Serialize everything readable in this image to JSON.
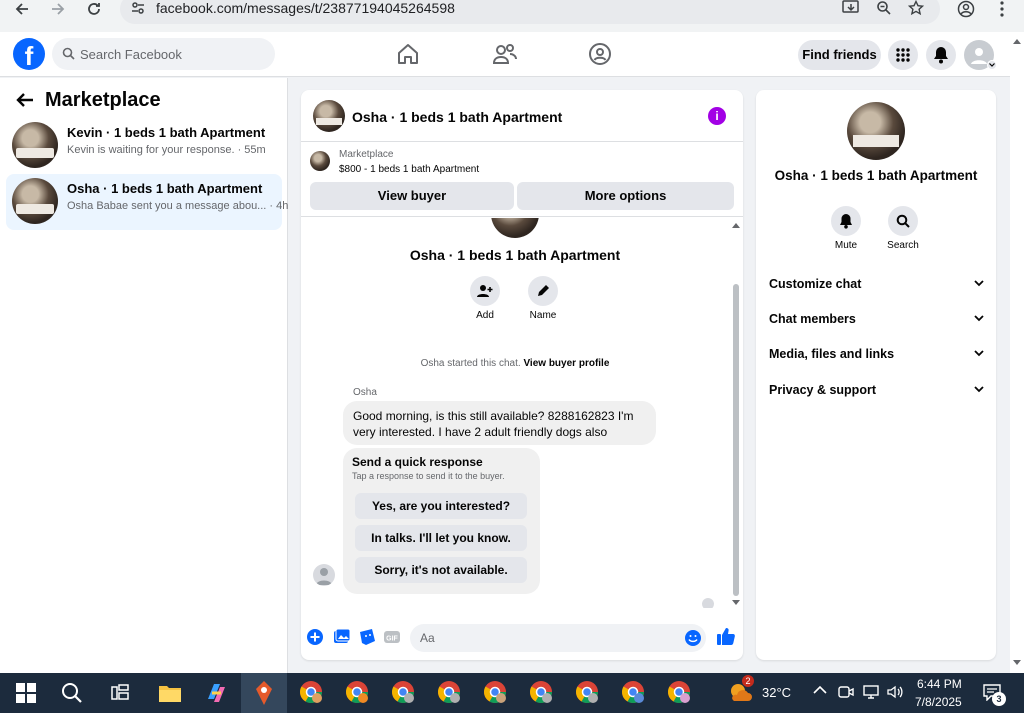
{
  "browser": {
    "url": "facebook.com/messages/t/23877194045264598"
  },
  "header": {
    "search_placeholder": "Search Facebook",
    "find_friends_label": "Find friends"
  },
  "sidebar": {
    "title": "Marketplace",
    "conversations": [
      {
        "name": "Kevin · 1 beds 1 bath Apartment",
        "preview": "Kevin is waiting for your response. · 55m",
        "active": false
      },
      {
        "name": "Osha · 1 beds 1 bath Apartment",
        "preview": "Osha Babae sent you a message abou... · 4h",
        "active": true
      }
    ]
  },
  "chat": {
    "title": "Osha · 1 beds 1 bath Apartment",
    "marketplace_label": "Marketplace",
    "listing": "$800 - 1 beds 1 bath Apartment",
    "view_buyer_label": "View buyer",
    "more_options_label": "More options",
    "conversation_title": "Osha · 1 beds 1 bath Apartment",
    "actions": [
      {
        "label": "Add",
        "icon": "add-person-icon"
      },
      {
        "label": "Name",
        "icon": "pencil-icon"
      }
    ],
    "started_text": "Osha started this chat.",
    "view_buyer_profile": "View buyer profile",
    "sender_name": "Osha",
    "message": "Good morning, is this still available? 8288162823 I'm very interested. I have 2 adult friendly dogs also",
    "quick_response": {
      "title": "Send a quick response",
      "subtitle": "Tap a response to send it to the buyer.",
      "options": [
        "Yes, are you interested?",
        "In talks. I'll let you know.",
        "Sorry, it's not available."
      ]
    },
    "composer_placeholder": "Aa"
  },
  "right_panel": {
    "title": "Osha · 1 beds 1 bath Apartment",
    "actions": [
      {
        "label": "Mute",
        "icon": "bell-icon"
      },
      {
        "label": "Search",
        "icon": "search-icon"
      }
    ],
    "sections": [
      "Customize chat",
      "Chat members",
      "Media, files and links",
      "Privacy & support"
    ]
  },
  "taskbar": {
    "weather": "32°C",
    "time": "6:44 PM",
    "date": "7/8/2025",
    "notification_count": "3",
    "badge_count": "2"
  },
  "colors": {
    "facebook_blue": "#0866ff",
    "info_purple": "#a200e5",
    "active_item_bg": "#ebf5ff",
    "taskbar_bg": "#1c2b3d"
  }
}
